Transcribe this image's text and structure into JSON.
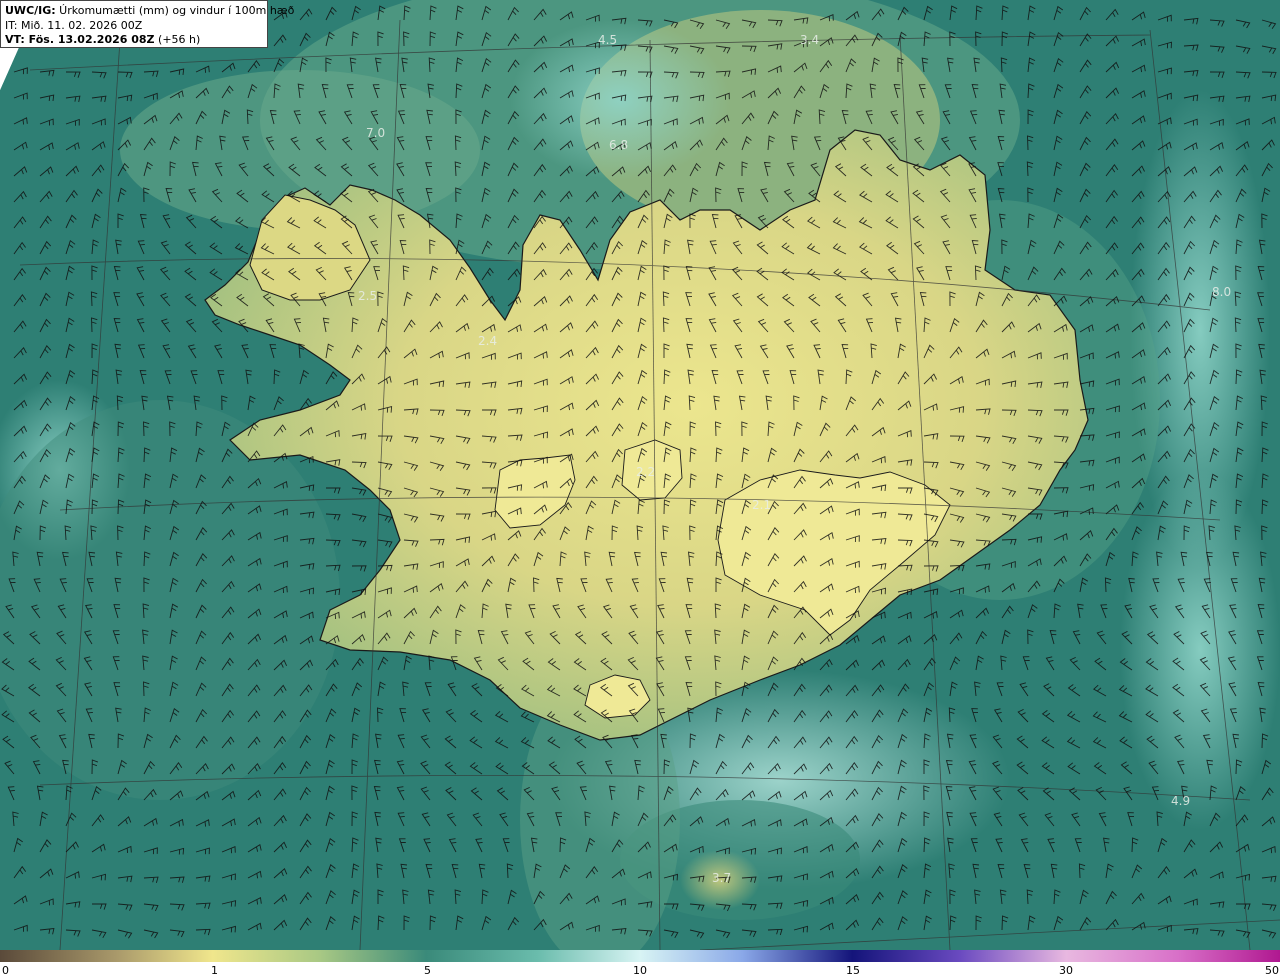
{
  "header": {
    "title_bold": "UWC/IG:",
    "title_rest": " Úrkomumætti (mm) og vindur í 100m hæð",
    "init_time": "IT: Mið. 11. 02. 2026 00Z",
    "valid_bold": "VT: Fös. 13.02.2026 08Z",
    "valid_rest": " (+56 h)"
  },
  "map_labels": [
    "4.5",
    "3.4",
    "7.0",
    "6.8",
    "8.0",
    "2.5",
    "2.4",
    "4.9",
    "3.7",
    "2.2",
    "2.1"
  ],
  "colorbar": {
    "ticks": [
      "0",
      "1",
      "5",
      "10",
      "15",
      "30",
      "50"
    ],
    "colors": {
      "dry": "#5a4a3a",
      "low": "#f0e68c",
      "mid": "#3a8a7a",
      "high": "#d8f4f4",
      "very_high": "#14147a",
      "max": "#d040b0"
    }
  },
  "palette": {
    "sea_deep": "#2e7f74",
    "sea_mid": "#4a9a88",
    "land_low": "#c9c97a",
    "land_high": "#e6e28c",
    "coast": "#1a1a1a",
    "grid": "#333333",
    "barb": "#111111"
  }
}
